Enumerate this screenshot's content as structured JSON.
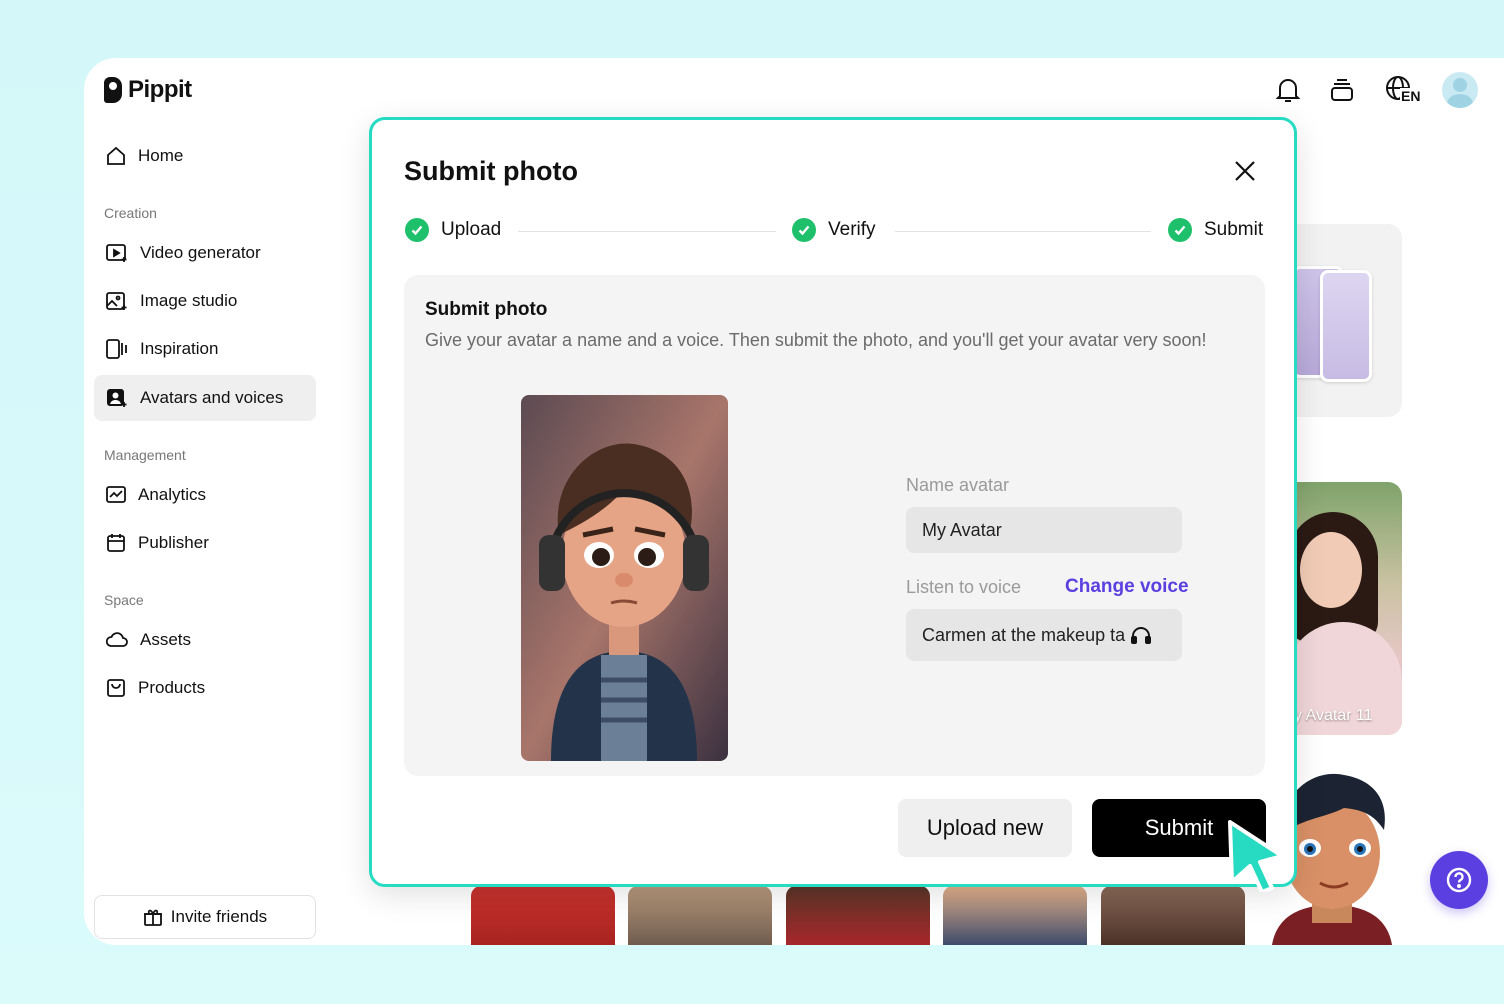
{
  "app": {
    "logo": "Pippit",
    "language": "EN"
  },
  "sidebar": {
    "home": "Home",
    "sections": {
      "creation": "Creation",
      "management": "Management",
      "space": "Space"
    },
    "items": {
      "video_generator": "Video generator",
      "image_studio": "Image studio",
      "inspiration": "Inspiration",
      "avatars_and_voices": "Avatars and voices",
      "analytics": "Analytics",
      "publisher": "Publisher",
      "assets": "Assets",
      "products": "Products"
    },
    "invite": "Invite friends"
  },
  "background": {
    "avatar_card_label": "y Avatar 11"
  },
  "modal": {
    "title": "Submit photo",
    "steps": [
      "Upload",
      "Verify",
      "Submit"
    ],
    "panel_title": "Submit photo",
    "panel_description": "Give your avatar a name and a voice. Then submit the photo, and you'll get your avatar very soon!",
    "name_label": "Name avatar",
    "name_value": "My Avatar",
    "voice_label": "Listen to voice",
    "change_voice": "Change voice",
    "voice_value": "Carmen at the makeup ta",
    "upload_new": "Upload new",
    "submit": "Submit"
  },
  "colors": {
    "accent": "#5b3fe0",
    "modal_border": "#26dbc2",
    "step_check": "#1fc06b"
  },
  "icons": [
    "bell-icon",
    "stack-icon",
    "globe-icon",
    "home-icon",
    "video-plus-icon",
    "image-sparkle-icon",
    "inspiration-icon",
    "avatar-icon",
    "analytics-icon",
    "calendar-icon",
    "cloud-icon",
    "product-bag-icon",
    "gift-icon",
    "close-icon",
    "check-icon",
    "headphones-icon",
    "help-icon",
    "cursor-icon"
  ]
}
